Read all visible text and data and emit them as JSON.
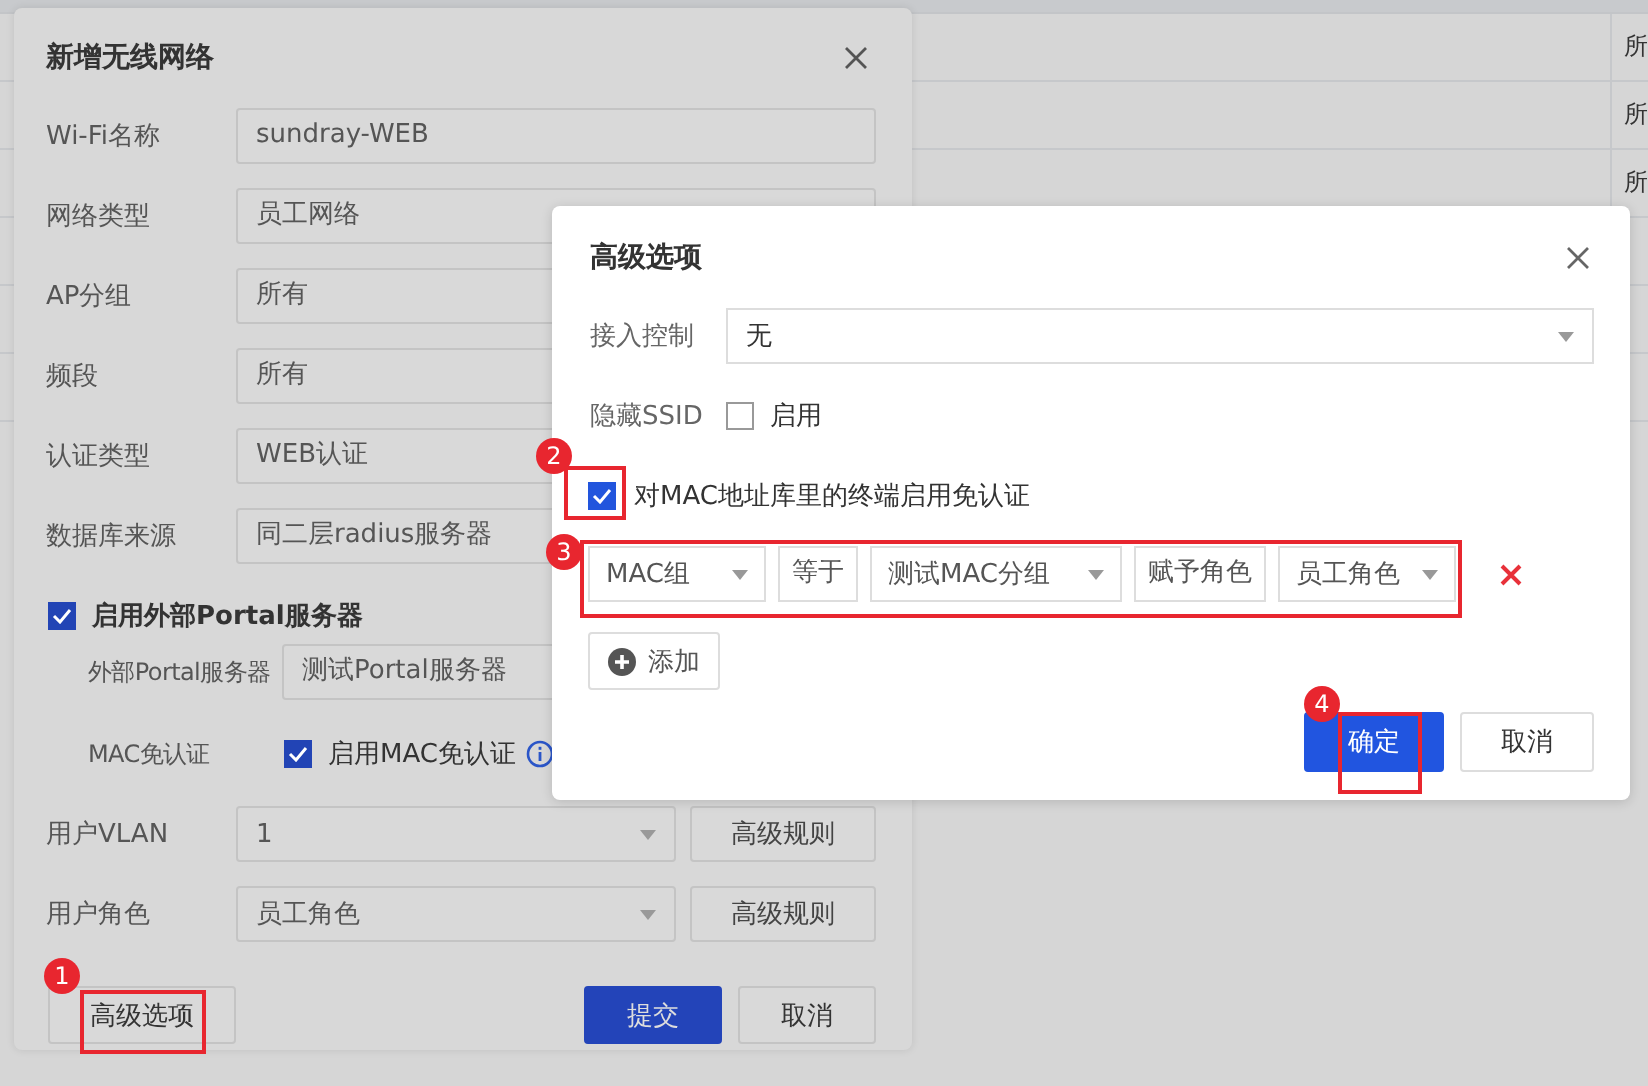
{
  "background_table": {
    "column_cells": [
      "所",
      "所",
      "所"
    ]
  },
  "network_dialog": {
    "title": "新增无线网络",
    "fields": [
      {
        "label": "Wi-Fi名称",
        "value": "sundray-WEB"
      },
      {
        "label": "网络类型",
        "value": "员工网络"
      },
      {
        "label": "AP分组",
        "value": "所有"
      },
      {
        "label": "频段",
        "value": "所有"
      },
      {
        "label": "认证类型",
        "value": "WEB认证"
      },
      {
        "label": "数据库来源",
        "value": "同二层radius服务器"
      }
    ],
    "portal": {
      "label": "启用外部Portal服务器",
      "checked": true,
      "server_label": "外部Portal服务器",
      "server_value": "测试Portal服务器",
      "mac_label": "MAC免认证",
      "mac_option": "启用MAC免认证",
      "mac_checked": true
    },
    "role_fields": [
      {
        "label": "用户VLAN",
        "value": "1",
        "button": "高级规则"
      },
      {
        "label": "用户角色",
        "value": "员工角色",
        "button": "高级规则"
      }
    ],
    "buttons": [
      {
        "label": "高级选项",
        "kind": "default"
      },
      {
        "label": "提交",
        "kind": "primary"
      },
      {
        "label": "取消",
        "kind": "default"
      }
    ]
  },
  "advanced_dialog": {
    "title": "高级选项",
    "access_control": {
      "label": "接入控制",
      "value": "无"
    },
    "hide_ssid": {
      "label": "隐藏SSID",
      "option": "启用",
      "checked": false
    },
    "mac_exempt": {
      "label": "对MAC地址库里的终端启用免认证",
      "checked": true
    },
    "rule": [
      {
        "kind": "select",
        "value": "MAC组"
      },
      {
        "kind": "text",
        "value": "等于"
      },
      {
        "kind": "select",
        "value": "测试MAC分组"
      },
      {
        "kind": "text",
        "value": "赋予角色"
      },
      {
        "kind": "select",
        "value": "员工角色"
      }
    ],
    "add_button": "添加",
    "buttons": [
      {
        "label": "确定",
        "kind": "primary"
      },
      {
        "label": "取消",
        "kind": "default"
      }
    ]
  },
  "annotations": [
    {
      "number": "1"
    },
    {
      "number": "2"
    },
    {
      "number": "3"
    },
    {
      "number": "4"
    }
  ]
}
